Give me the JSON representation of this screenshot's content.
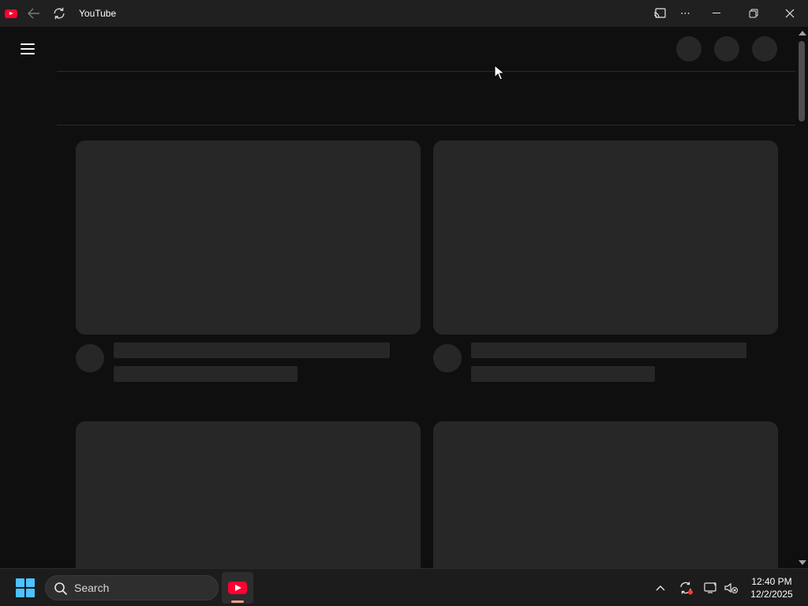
{
  "window": {
    "title": "YouTube",
    "app_icon": "youtube-logo-icon",
    "buttons": {
      "back": "arrow-left-icon",
      "refresh": "refresh-icon",
      "cast": "cast-icon",
      "more": "⋯",
      "minimize": "minimize-icon",
      "maximize": "restore-icon",
      "close": "close-icon"
    }
  },
  "page": {
    "state": "loading-skeleton",
    "menu_icon": "hamburger-menu-icon",
    "background_color": "#0f0f0f",
    "placeholder_color": "#272727"
  },
  "taskbar": {
    "search": {
      "label": "Search",
      "icon": "search-icon"
    },
    "pinned": [
      "youtube-app-icon"
    ],
    "tray_icons": [
      "chevron-up-icon",
      "sync-icon",
      "display-icon",
      "volume-muted-icon"
    ],
    "clock": {
      "time": "12:40 PM",
      "date": "12/2/2025"
    }
  }
}
